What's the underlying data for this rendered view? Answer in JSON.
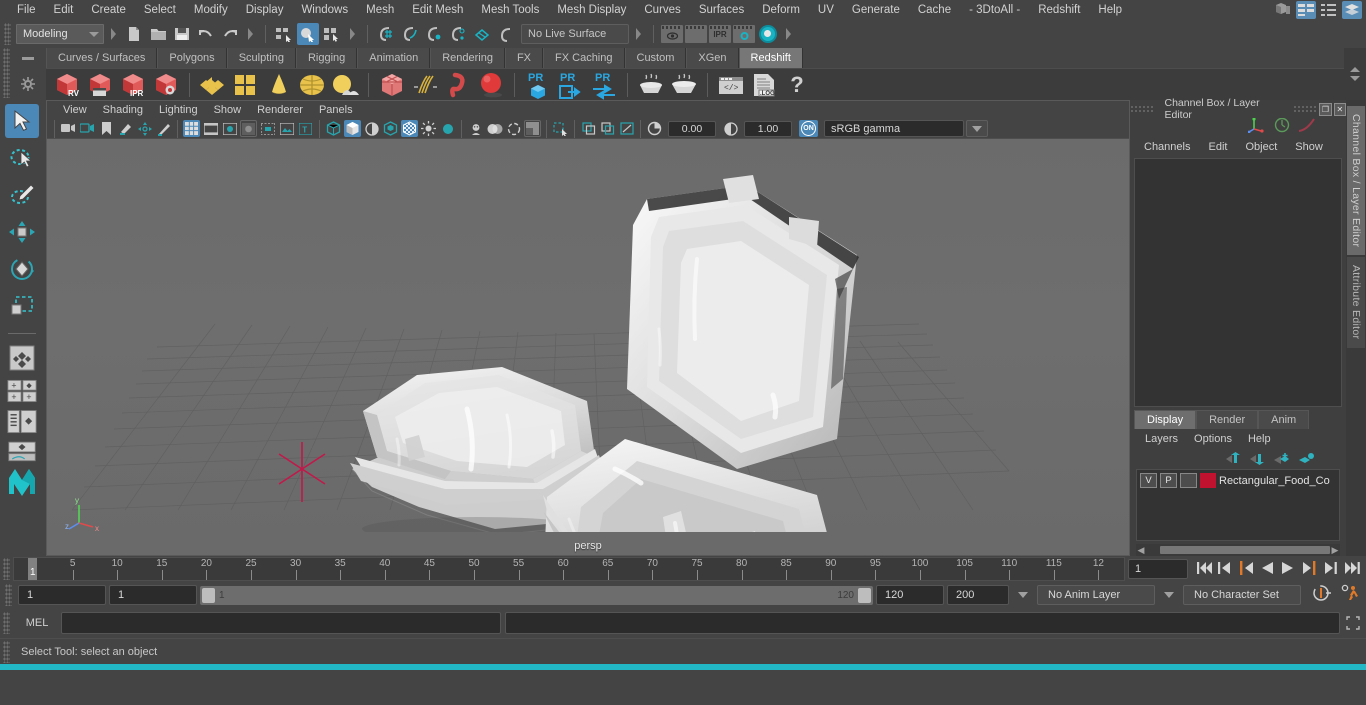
{
  "menubar": {
    "items": [
      "File",
      "Edit",
      "Create",
      "Select",
      "Modify",
      "Display",
      "Windows",
      "Mesh",
      "Edit Mesh",
      "Mesh Tools",
      "Mesh Display",
      "Curves",
      "Surfaces",
      "Deform",
      "UV",
      "Generate",
      "Cache",
      "- 3DtoAll -",
      "Redshift",
      "Help"
    ],
    "right_icons": [
      "modeling-toolkit-icon",
      "attribute-editor-icon",
      "outliner-icon",
      "channel-box-icon"
    ]
  },
  "statusbar": {
    "mode": "Modeling",
    "live_surface": "No Live Surface",
    "icons": [
      "new-scene-icon",
      "open-scene-icon",
      "save-scene-icon",
      "undo-icon",
      "redo-icon",
      "select-hierarchy-icon",
      "select-object-icon",
      "select-component-icon",
      "snap-grid-icon",
      "snap-curve-icon",
      "snap-point-icon",
      "snap-projected-center-icon",
      "snap-view-plane-icon",
      "make-live-icon",
      "render-view-icon",
      "render-sequence-icon",
      "ipr-render-icon",
      "render-settings-icon",
      "hypershade-icon"
    ]
  },
  "shelf": {
    "tabs": [
      "Curves / Surfaces",
      "Polygons",
      "Sculpting",
      "Rigging",
      "Animation",
      "Rendering",
      "FX",
      "FX Caching",
      "Custom",
      "XGen",
      "Redshift"
    ],
    "active_tab": "Redshift",
    "icons": [
      "redshift-rv-icon",
      "redshift-render-sequence-icon",
      "redshift-ipr-icon",
      "redshift-settings-icon",
      "redshift-proxy-icon",
      "redshift-matte-icon",
      "redshift-light-dome-icon",
      "redshift-light-area-icon",
      "redshift-light-portal-icon",
      "redshift-volume-icon",
      "redshift-hair-icon",
      "redshift-curve-icon",
      "redshift-sphere-icon",
      "redshift-pr-cube-icon",
      "redshift-pr-export-icon",
      "redshift-pr-swap-icon",
      "redshift-bake-icon",
      "redshift-bake-set-icon",
      "redshift-script-icon",
      "redshift-log-icon",
      "redshift-help-icon"
    ],
    "labels": {
      "rv": "RV",
      "ipr": "IPR",
      "pr": "PR",
      "log": ".LOG",
      "help": "?"
    }
  },
  "toolbox": {
    "items": [
      "select-tool",
      "lasso-select-tool",
      "paint-select-tool",
      "move-tool",
      "rotate-tool",
      "scale-tool",
      "last-tool-used",
      "snap-grid-set",
      "quick-layout-four",
      "quick-layout-outliner",
      "quick-layout-graph",
      "maya-logo"
    ]
  },
  "viewport": {
    "menu": [
      "View",
      "Shading",
      "Lighting",
      "Show",
      "Renderer",
      "Panels"
    ],
    "toolbar_icons": [
      "select-camera-icon",
      "camera-attributes-icon",
      "bookmark-icon",
      "image-plane-icon",
      "two-d-pan-zoom-icon",
      "grease-pencil-icon",
      "grid-toggle-icon",
      "film-gate-icon",
      "resolution-gate-icon",
      "gate-mask-icon",
      "film-origin-icon",
      "safe-action-icon",
      "text-overlay-icon",
      "wireframe-icon",
      "smooth-shade-icon",
      "shaded-wire-icon",
      "textured-icon",
      "use-all-lights-icon",
      "shadows-icon",
      "screen-space-ao-icon",
      "motion-blur-icon",
      "multisample-icon",
      "depth-of-field-icon",
      "isolate-select-icon",
      "xray-icon",
      "xray-joints-icon",
      "xray-active-components-icon",
      "exposure-icon",
      "gamma-icon",
      "view-transform-icon"
    ],
    "exposure_value": "0.00",
    "gamma_value": "1.00",
    "color_management": "sRGB gamma",
    "camera_label": "persp",
    "gizmo_axes": [
      "y",
      "z",
      "x"
    ]
  },
  "channel_box": {
    "title": "Channel Box / Layer Editor",
    "menu": [
      "Channels",
      "Edit",
      "Object",
      "Show"
    ],
    "restore_icon": "restore-panel-icon",
    "close_icon": "close-panel-icon"
  },
  "layer_editor": {
    "tabs": [
      "Display",
      "Render",
      "Anim"
    ],
    "active_tab": "Display",
    "menu": [
      "Layers",
      "Options",
      "Help"
    ],
    "buttons": [
      "move-layer-up-icon",
      "move-layer-down-icon",
      "new-layer-icon",
      "new-layer-from-selected-icon"
    ],
    "layers": [
      {
        "visibility": "V",
        "playback": "P",
        "shading": "",
        "color": "#c1122f",
        "name": "Rectangular_Food_Co"
      }
    ]
  },
  "side_tabs": {
    "items": [
      "Channel Box / Layer Editor",
      "Attribute Editor"
    ],
    "active": "Channel Box / Layer Editor"
  },
  "timeline": {
    "tick_labels": [
      "5",
      "10",
      "15",
      "20",
      "25",
      "30",
      "35",
      "40",
      "45",
      "50",
      "55",
      "60",
      "65",
      "70",
      "75",
      "80",
      "85",
      "90",
      "95",
      "100",
      "105",
      "110",
      "115",
      "12"
    ],
    "current_frame": "1",
    "current_frame_field": "1",
    "playback_buttons": [
      "go-to-start-icon",
      "step-back-keyframe-icon",
      "step-back-frame-icon",
      "play-backwards-icon",
      "play-forwards-icon",
      "step-forward-frame-icon",
      "step-forward-keyframe-icon",
      "go-to-end-icon"
    ]
  },
  "range": {
    "anim_start": "1",
    "range_start": "1",
    "slider_start_label": "1",
    "slider_end_label": "120",
    "range_end": "120",
    "anim_end": "200",
    "anim_layer": "No Anim Layer",
    "character_set": "No Character Set",
    "right_icons": [
      "auto-key-icon",
      "animation-preferences-icon"
    ]
  },
  "command_line": {
    "label": "MEL",
    "input_value": "",
    "expand_icon": "expand-script-editor-icon"
  },
  "help_line": {
    "text": "Select Tool: select an object"
  },
  "colors": {
    "accent_blue": "#4b88b8",
    "teal": "#19b3c4",
    "redshift_red": "#d8414a",
    "layer_red": "#c1122f",
    "panel_bg": "#444444",
    "viewport_bg": "#6e6e6e",
    "orange": "#e07a28"
  }
}
